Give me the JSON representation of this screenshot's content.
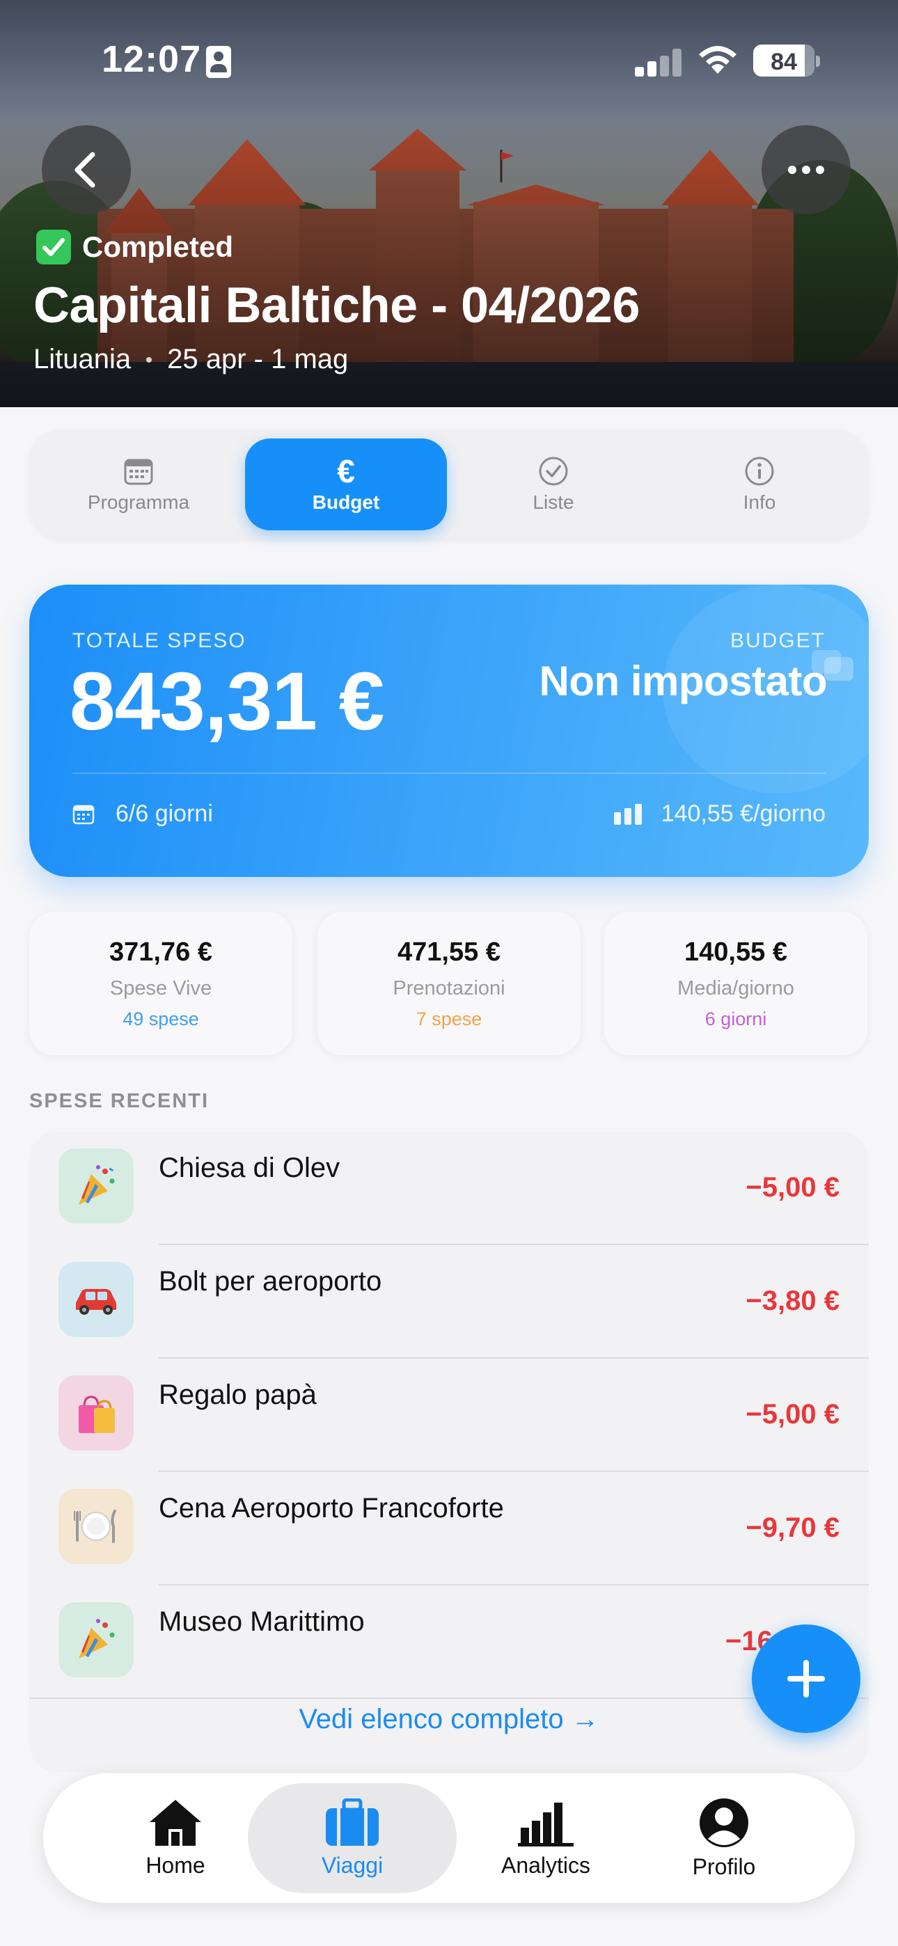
{
  "status_bar": {
    "time": "12:07",
    "battery": "84"
  },
  "trip": {
    "status_label": "Completed",
    "title": "Capitali Baltiche - 04/2026",
    "country": "Lituania",
    "dates": "25 apr - 1 mag"
  },
  "tabs": [
    {
      "label": "Programma",
      "icon": "calendar-icon"
    },
    {
      "label": "Budget",
      "icon": "euro-icon",
      "active": true
    },
    {
      "label": "Liste",
      "icon": "checkmark-circle-icon"
    },
    {
      "label": "Info",
      "icon": "info-icon"
    }
  ],
  "summary": {
    "total_label": "TOTALE SPESO",
    "total_value": "843,31 €",
    "budget_label": "BUDGET",
    "budget_value": "Non impostato",
    "days": "6/6 giorni",
    "per_day": "140,55 €/giorno"
  },
  "stats": [
    {
      "value": "371,76 €",
      "label": "Spese Vive",
      "caption": "49 spese",
      "color": "#3f9ef5"
    },
    {
      "value": "471,55 €",
      "label": "Prenotazioni",
      "caption": "7 spese",
      "color": "#f3a24a"
    },
    {
      "value": "140,55 €",
      "label": "Media/giorno",
      "caption": "6 giorni",
      "color": "#c160d6"
    }
  ],
  "recent": {
    "title": "SPESE RECENTI",
    "items": [
      {
        "name": "Chiesa di Olev",
        "amount": "−5,00 €",
        "icon": "party-popper-icon",
        "bg": "#d6ece2"
      },
      {
        "name": "Bolt per aeroporto",
        "amount": "−3,80 €",
        "icon": "car-icon",
        "bg": "#d3e8f0"
      },
      {
        "name": "Regalo papà",
        "amount": "−5,00 €",
        "icon": "shopping-bags-icon",
        "bg": "#f2d6e2"
      },
      {
        "name": "Cena Aeroporto Francoforte",
        "amount": "−9,70 €",
        "icon": "plate-cutlery-icon",
        "bg": "#f5e6d2"
      },
      {
        "name": "Museo Marittimo",
        "amount": "−16",
        "icon": "party-popper-icon",
        "bg": "#d6ece2"
      }
    ],
    "view_all": "Vedi elenco completo →"
  },
  "tabbar": [
    {
      "label": "Home",
      "icon": "home-icon"
    },
    {
      "label": "Viaggi",
      "icon": "suitcase-icon",
      "active": true
    },
    {
      "label": "Analytics",
      "icon": "bar-chart-icon"
    },
    {
      "label": "Profilo",
      "icon": "profile-icon"
    }
  ],
  "colors": {
    "accent": "#1690f8",
    "negative": "#e8373a",
    "completed": "#34c759"
  }
}
